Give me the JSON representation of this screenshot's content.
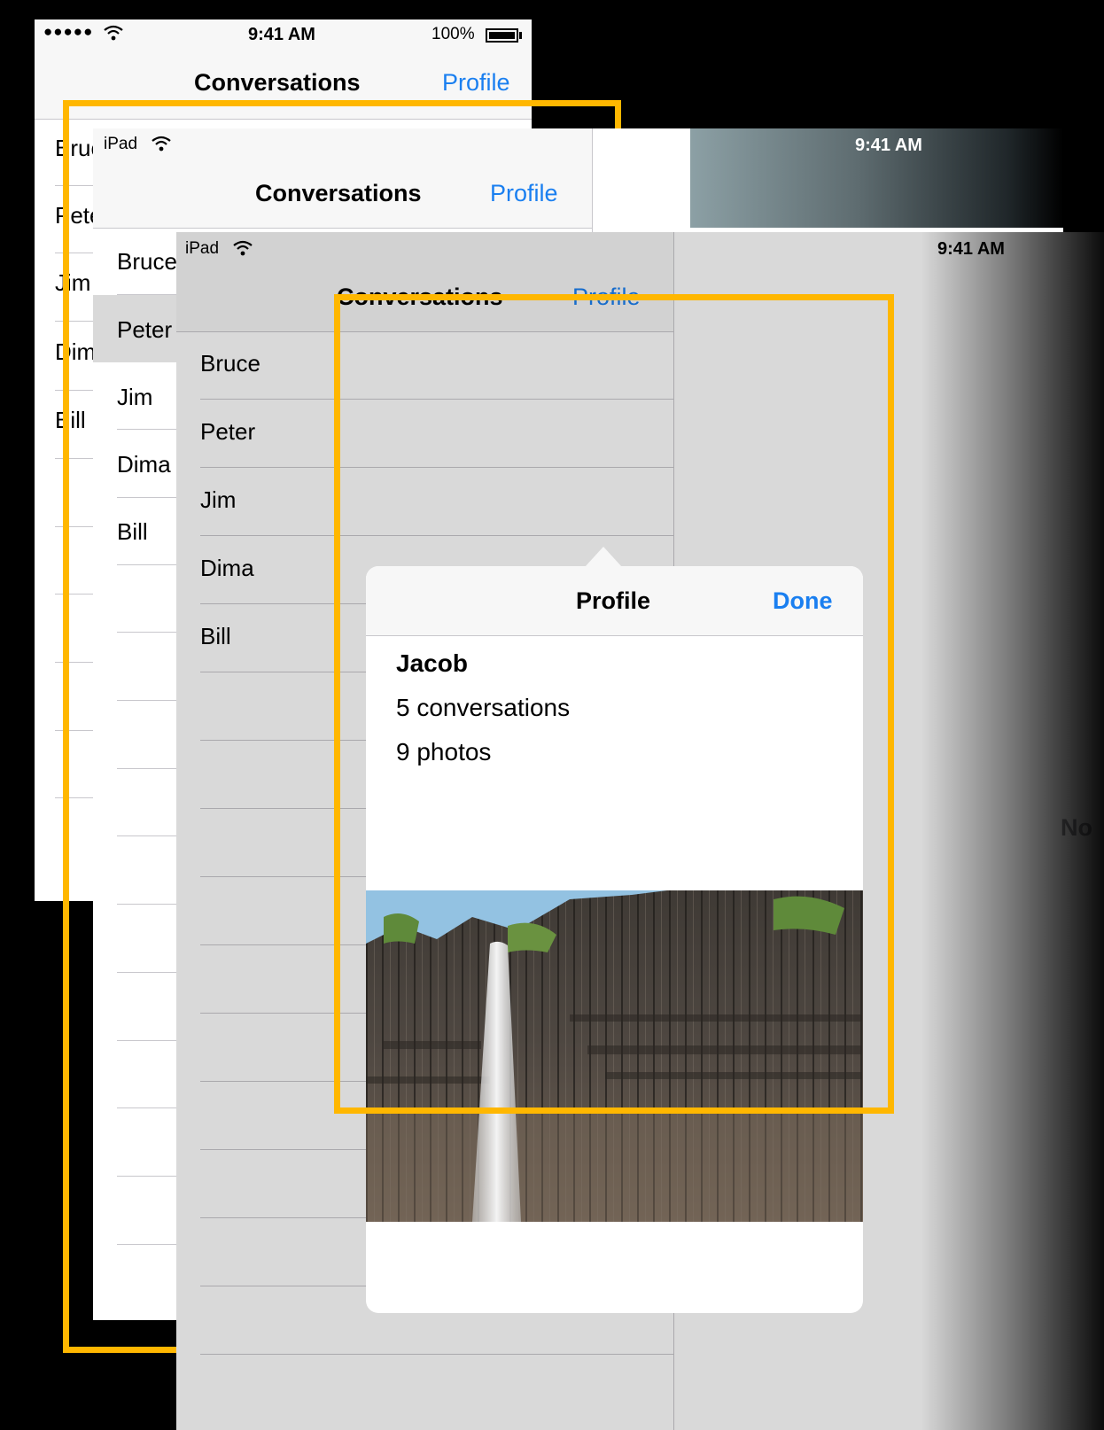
{
  "status_bar": {
    "iphone_time": "9:41 AM",
    "battery_percent": "100%",
    "ipad_label": "iPad",
    "ipad_time": "9:41 AM"
  },
  "nav": {
    "title": "Conversations",
    "profile_button": "Profile"
  },
  "conversations": [
    "Bruce",
    "Peter",
    "Jim",
    "Dima",
    "Bill"
  ],
  "popover": {
    "title": "Profile",
    "done_button": "Done",
    "name": "Jacob",
    "conversations_count": "5 conversations",
    "photos_count": "9 photos",
    "photo_icon": "waterfall-photo"
  },
  "detail": {
    "placeholder_text": "No"
  },
  "colors": {
    "tint": "#1a7ff0",
    "highlight": "#ffb700"
  }
}
